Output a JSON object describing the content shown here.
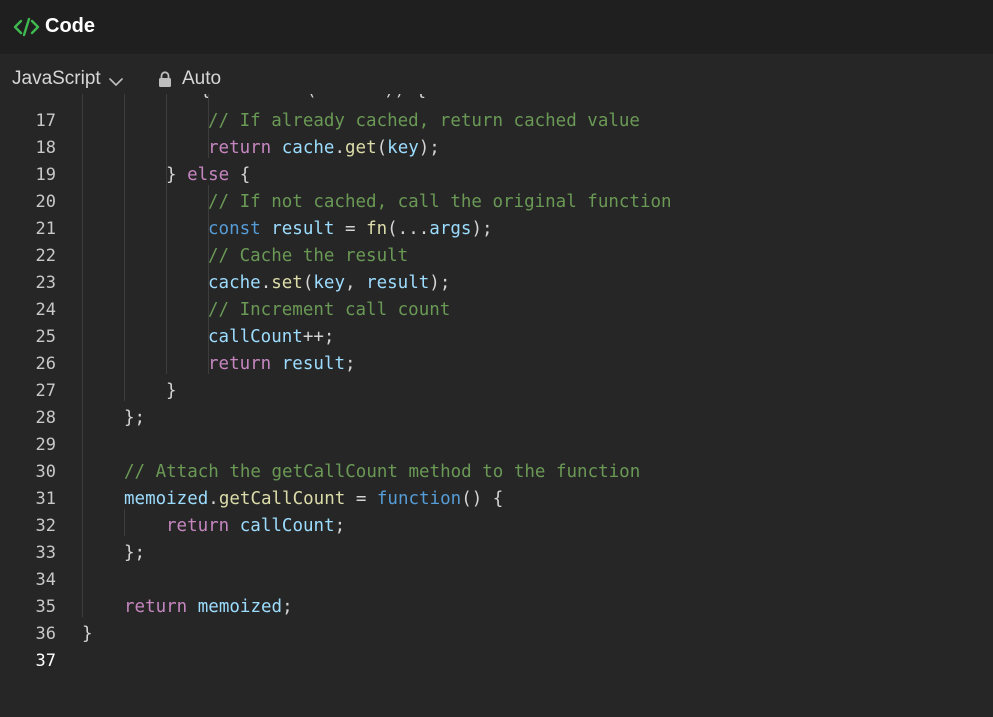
{
  "window": {
    "title": "Code"
  },
  "toolbar": {
    "language": "JavaScript",
    "mode": "Auto"
  },
  "icons": {
    "code": "code-brackets-icon",
    "chevron": "chevron-down-icon",
    "lock": "lock-icon"
  },
  "colors": {
    "accent_icon": "#3fb950",
    "background": "#262626",
    "titlebar": "#1f1f1f",
    "keyword_control": "#c586c0",
    "keyword": "#569cd6",
    "variable": "#9cdcfe",
    "function": "#dcdcaa",
    "comment": "#6a9955"
  },
  "editor": {
    "lines": [
      {
        "num": "17",
        "tokens": [
          [
            "cm",
            "// If already cached, return cached value"
          ]
        ]
      },
      {
        "num": "18",
        "tokens": [
          [
            "kw-ctrl",
            "return"
          ],
          [
            "pn",
            " "
          ],
          [
            "var",
            "cache"
          ],
          [
            "pn",
            "."
          ],
          [
            "fn",
            "get"
          ],
          [
            "pn",
            "("
          ],
          [
            "var",
            "key"
          ],
          [
            "pn",
            ");"
          ]
        ]
      },
      {
        "num": "19",
        "tokens": [
          [
            "pn",
            "} "
          ],
          [
            "kw-ctrl",
            "else"
          ],
          [
            "pn",
            " {"
          ]
        ]
      },
      {
        "num": "20",
        "tokens": [
          [
            "cm",
            "// If not cached, call the original function"
          ]
        ]
      },
      {
        "num": "21",
        "tokens": [
          [
            "kw",
            "const"
          ],
          [
            "pn",
            " "
          ],
          [
            "var",
            "result"
          ],
          [
            "pn",
            " = "
          ],
          [
            "fn",
            "fn"
          ],
          [
            "pn",
            "(..."
          ],
          [
            "var",
            "args"
          ],
          [
            "pn",
            ");"
          ]
        ]
      },
      {
        "num": "22",
        "tokens": [
          [
            "cm",
            "// Cache the result"
          ]
        ]
      },
      {
        "num": "23",
        "tokens": [
          [
            "var",
            "cache"
          ],
          [
            "pn",
            "."
          ],
          [
            "fn",
            "set"
          ],
          [
            "pn",
            "("
          ],
          [
            "var",
            "key"
          ],
          [
            "pn",
            ", "
          ],
          [
            "var",
            "result"
          ],
          [
            "pn",
            ");"
          ]
        ]
      },
      {
        "num": "24",
        "tokens": [
          [
            "cm",
            "// Increment call count"
          ]
        ]
      },
      {
        "num": "25",
        "tokens": [
          [
            "var",
            "callCount"
          ],
          [
            "pn",
            "++;"
          ]
        ]
      },
      {
        "num": "26",
        "tokens": [
          [
            "kw-ctrl",
            "return"
          ],
          [
            "pn",
            " "
          ],
          [
            "var",
            "result"
          ],
          [
            "pn",
            ";"
          ]
        ]
      },
      {
        "num": "27",
        "tokens": [
          [
            "pn",
            "}"
          ]
        ]
      },
      {
        "num": "28",
        "tokens": [
          [
            "pn",
            "};"
          ]
        ]
      },
      {
        "num": "29",
        "tokens": []
      },
      {
        "num": "30",
        "tokens": [
          [
            "cm",
            "// Attach the getCallCount method to the function"
          ]
        ]
      },
      {
        "num": "31",
        "tokens": [
          [
            "var",
            "memoized"
          ],
          [
            "pn",
            "."
          ],
          [
            "fn",
            "getCallCount"
          ],
          [
            "pn",
            " = "
          ],
          [
            "kw",
            "function"
          ],
          [
            "pn",
            "() {"
          ]
        ]
      },
      {
        "num": "32",
        "tokens": [
          [
            "kw-ctrl",
            "return"
          ],
          [
            "pn",
            " "
          ],
          [
            "var",
            "callCount"
          ],
          [
            "pn",
            ";"
          ]
        ]
      },
      {
        "num": "33",
        "tokens": [
          [
            "pn",
            "};"
          ]
        ]
      },
      {
        "num": "34",
        "tokens": []
      },
      {
        "num": "35",
        "tokens": [
          [
            "kw-ctrl",
            "return"
          ],
          [
            "pn",
            " "
          ],
          [
            "var",
            "memoized"
          ],
          [
            "pn",
            ";"
          ]
        ]
      },
      {
        "num": "36",
        "tokens": [
          [
            "pn",
            "}"
          ]
        ]
      },
      {
        "num": "37",
        "tokens": []
      }
    ]
  }
}
